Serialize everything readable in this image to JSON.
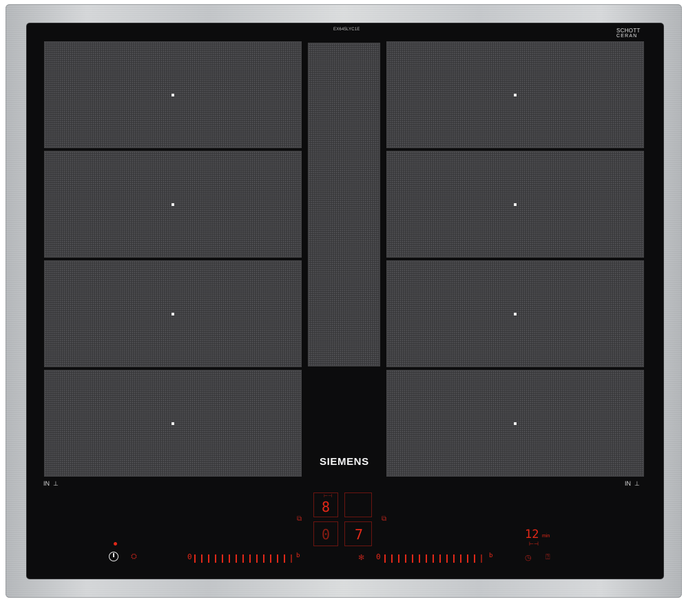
{
  "product": {
    "model": "EX645LYC1E",
    "brand": "SIEMENS",
    "glass_maker": {
      "line1": "SCHOTT",
      "line2": "CERAN"
    }
  },
  "zones": {
    "left": [
      "zone",
      "zone",
      "zone",
      "zone"
    ],
    "center": "flex bridge",
    "right": [
      "zone",
      "zone",
      "zone",
      "zone"
    ]
  },
  "labels": {
    "in_left": "IN",
    "in_right": "IN"
  },
  "displays": {
    "top_left_digit": "8",
    "bottom_left_digit": "0",
    "bottom_right_digit": "7",
    "timer_value": "12",
    "timer_unit": "min"
  },
  "colors": {
    "glass": "#0c0c0d",
    "zone": "#3a3a3c",
    "indicator_red": "#e12818",
    "frame": "#c8cacc"
  },
  "icons": [
    "power-icon",
    "child-lock-icon",
    "bridge-icon",
    "flex-icon",
    "timer-icon",
    "stopwatch-icon",
    "induction-icon"
  ]
}
